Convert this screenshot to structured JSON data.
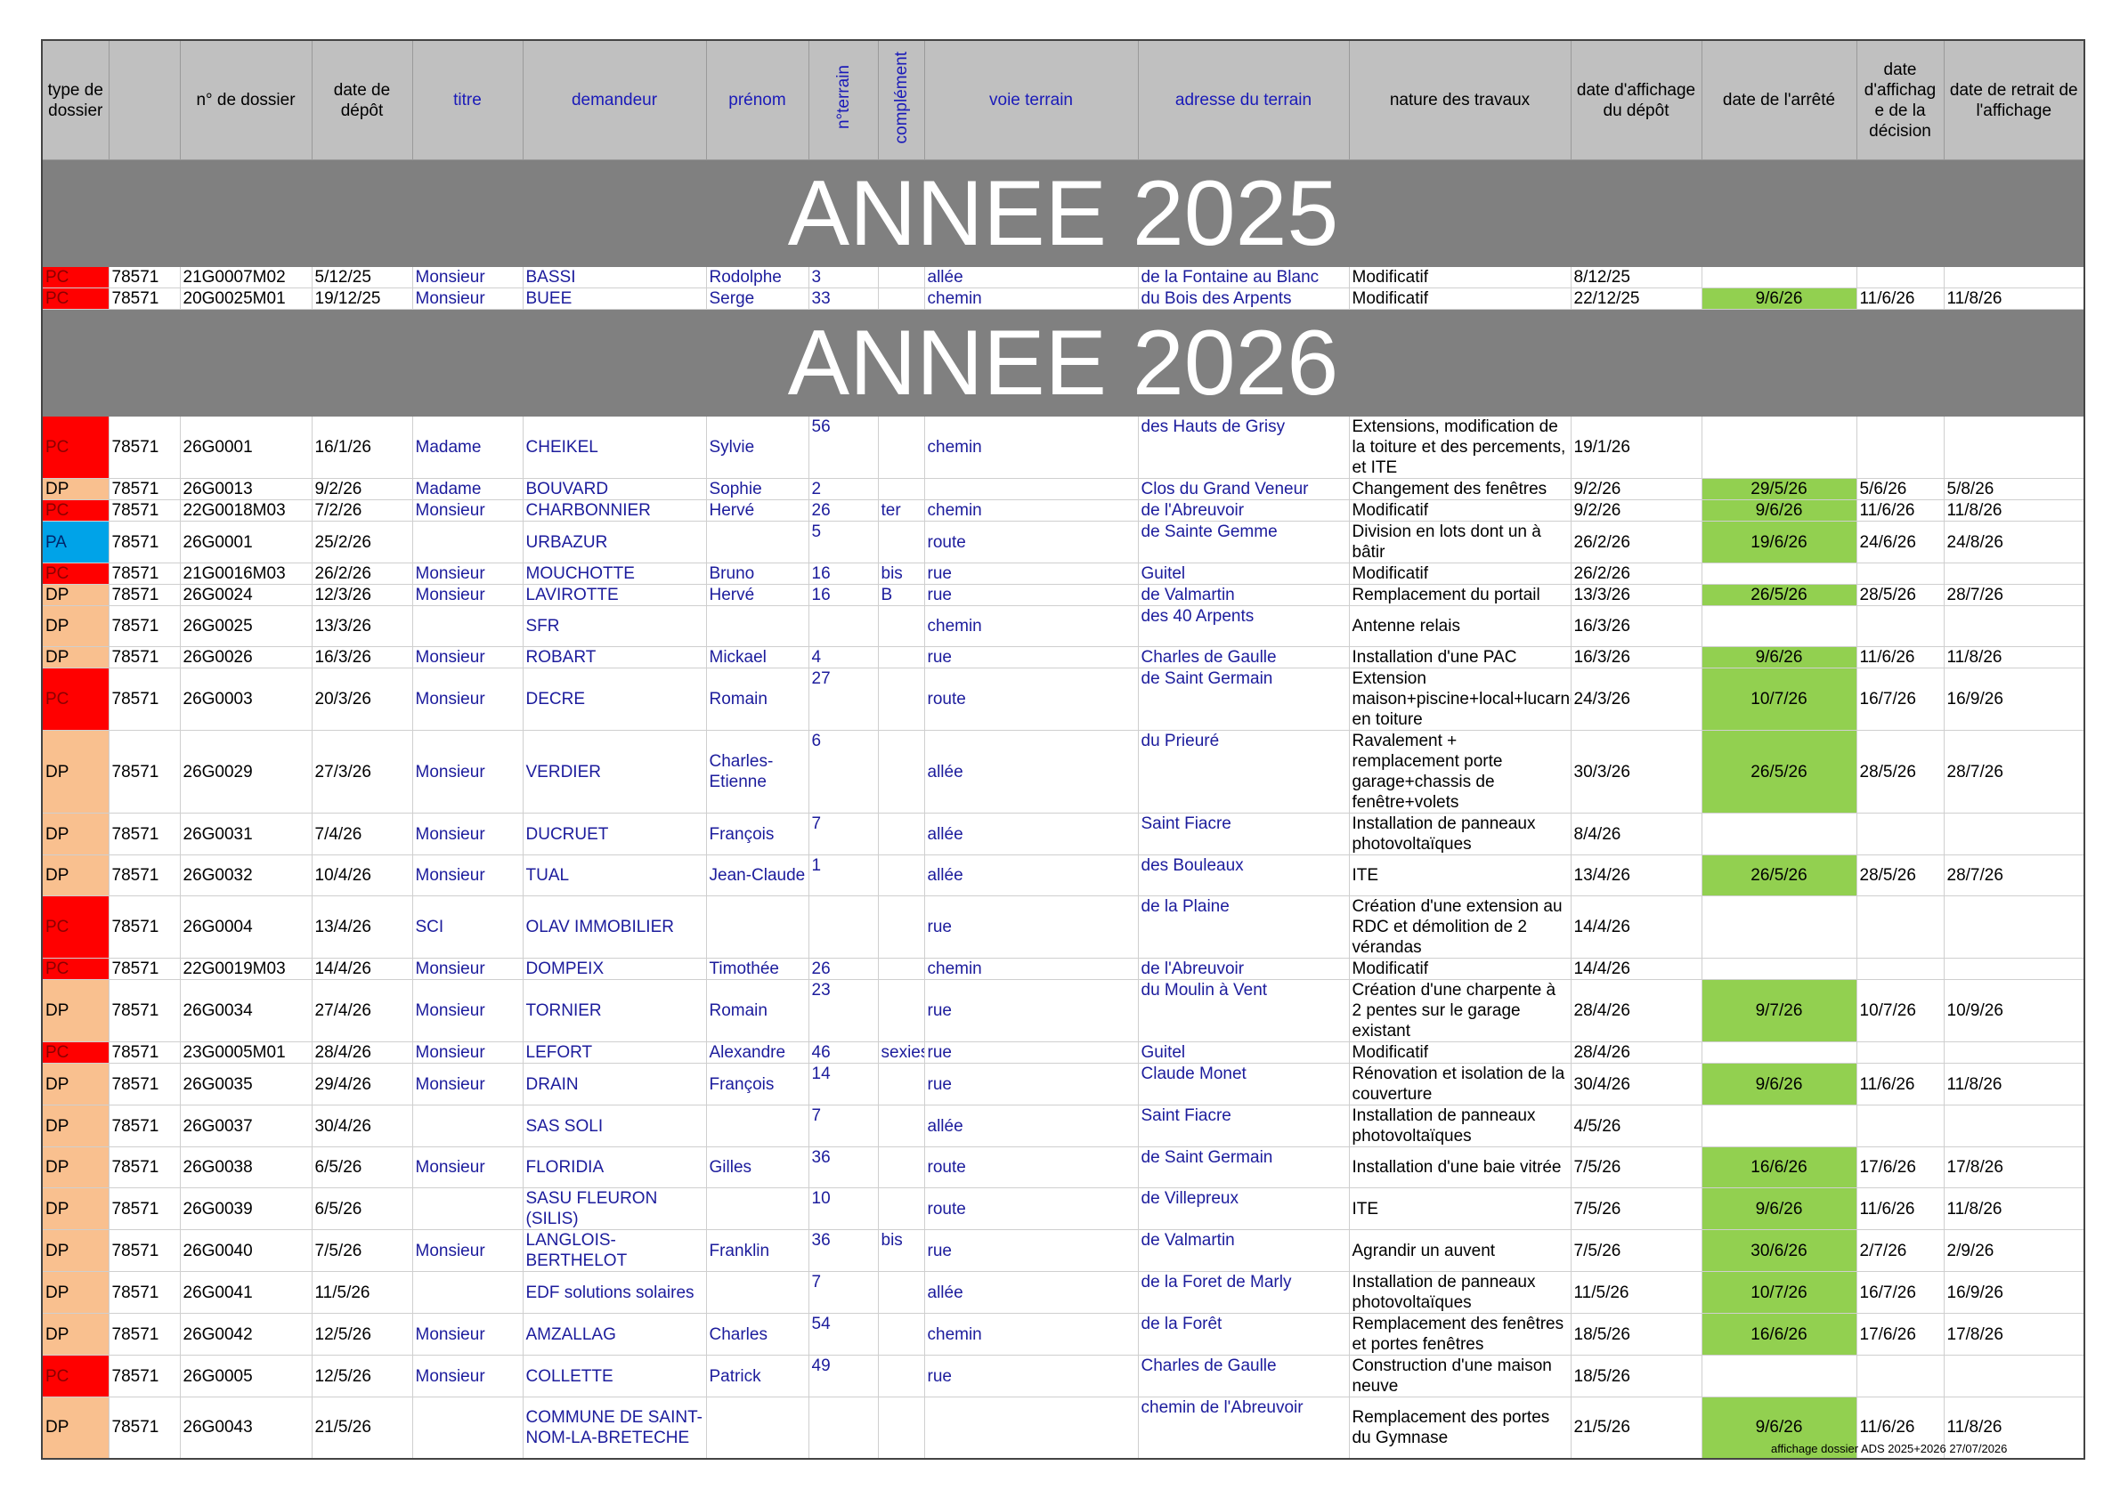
{
  "headers": [
    "type de dossier",
    "",
    "n° de dossier",
    "date de dépôt",
    "titre",
    "demandeur",
    "prénom",
    "n°terrain",
    "complément",
    "voie terrain",
    "adresse du terrain",
    "nature des travaux",
    "date d'affichage du dépôt",
    "date de l'arrêté",
    "date d'affichag e de la décision",
    "date de retrait de l'affichage"
  ],
  "year_2025": "ANNEE 2025",
  "year_2026": "ANNEE 2026",
  "rows_2025": [
    [
      "PC",
      "78571",
      "21G0007M02",
      "5/12/25",
      "Monsieur",
      "BASSI",
      "Rodolphe",
      "3",
      "",
      "allée",
      "de la Fontaine au Blanc",
      "Modificatif",
      "8/12/25",
      "",
      "",
      ""
    ],
    [
      "PC",
      "78571",
      "20G0025M01",
      "19/12/25",
      "Monsieur",
      "BUEE",
      "Serge",
      "33",
      "",
      "chemin",
      "du Bois des Arpents",
      "Modificatif",
      "22/12/25",
      "9/6/26",
      "11/6/26",
      "11/8/26"
    ]
  ],
  "rows_2026": [
    [
      "PC",
      "78571",
      "26G0001",
      "16/1/26",
      "Madame",
      "CHEIKEL",
      "Sylvie",
      "56",
      "",
      "chemin",
      "des Hauts de Grisy",
      "Extensions, modification de la toiture et des percements, et ITE",
      "19/1/26",
      "",
      "",
      ""
    ],
    [
      "DP",
      "78571",
      "26G0013",
      "9/2/26",
      "Madame",
      "BOUVARD",
      "Sophie",
      "2",
      "",
      "",
      "Clos du Grand Veneur",
      "Changement des fenêtres",
      "9/2/26",
      "29/5/26",
      "5/6/26",
      "5/8/26"
    ],
    [
      "PC",
      "78571",
      "22G0018M03",
      "7/2/26",
      "Monsieur",
      "CHARBONNIER",
      "Hervé",
      "26",
      "ter",
      "chemin",
      "de l'Abreuvoir",
      "Modificatif",
      "9/2/26",
      "9/6/26",
      "11/6/26",
      "11/8/26"
    ],
    [
      "PA",
      "78571",
      "26G0001",
      "25/2/26",
      "",
      "URBAZUR",
      "",
      "5",
      "",
      "route",
      "de Sainte Gemme",
      "Division en lots dont un à bâtir",
      "26/2/26",
      "19/6/26",
      "24/6/26",
      "24/8/26"
    ],
    [
      "PC",
      "78571",
      "21G0016M03",
      "26/2/26",
      "Monsieur",
      "MOUCHOTTE",
      "Bruno",
      "16",
      "bis",
      "rue",
      "Guitel",
      "Modificatif",
      "26/2/26",
      "",
      "",
      ""
    ],
    [
      "DP",
      "78571",
      "26G0024",
      "12/3/26",
      "Monsieur",
      "LAVIROTTE",
      "Hervé",
      "16",
      "B",
      "rue",
      "de Valmartin",
      "Remplacement du portail",
      "13/3/26",
      "26/5/26",
      "28/5/26",
      "28/7/26"
    ],
    [
      "DP",
      "78571",
      "26G0025",
      "13/3/26",
      "",
      "SFR",
      "",
      "",
      "",
      "chemin",
      "des 40 Arpents",
      "Antenne relais",
      "16/3/26",
      "",
      "",
      ""
    ],
    [
      "DP",
      "78571",
      "26G0026",
      "16/3/26",
      "Monsieur",
      "ROBART",
      "Mickael",
      "4",
      "",
      "rue",
      "Charles de Gaulle",
      "Installation d'une PAC",
      "16/3/26",
      "9/6/26",
      "11/6/26",
      "11/8/26"
    ],
    [
      "PC",
      "78571",
      "26G0003",
      "20/3/26",
      "Monsieur",
      "DECRE",
      "Romain",
      "27",
      "",
      "route",
      "de Saint Germain",
      "Extension maison+piscine+local+lucarnes en toiture",
      "24/3/26",
      "10/7/26",
      "16/7/26",
      "16/9/26"
    ],
    [
      "DP",
      "78571",
      "26G0029",
      "27/3/26",
      "Monsieur",
      "VERDIER",
      "Charles-Etienne",
      "6",
      "",
      "allée",
      "du Prieuré",
      "Ravalement + remplacement porte garage+chassis de fenêtre+volets",
      "30/3/26",
      "26/5/26",
      "28/5/26",
      "28/7/26"
    ],
    [
      "DP",
      "78571",
      "26G0031",
      "7/4/26",
      "Monsieur",
      "DUCRUET",
      "François",
      "7",
      "",
      "allée",
      "Saint Fiacre",
      "Installation de panneaux photovoltaïques",
      "8/4/26",
      "",
      "",
      ""
    ],
    [
      "DP",
      "78571",
      "26G0032",
      "10/4/26",
      "Monsieur",
      "TUAL",
      "Jean-Claude",
      "1",
      "",
      "allée",
      "des Bouleaux",
      "ITE",
      "13/4/26",
      "26/5/26",
      "28/5/26",
      "28/7/26"
    ],
    [
      "PC",
      "78571",
      "26G0004",
      "13/4/26",
      "SCI",
      "OLAV IMMOBILIER",
      "",
      "",
      "",
      "rue",
      "de la Plaine",
      "Création d'une extension au RDC et démolition de 2 vérandas",
      "14/4/26",
      "",
      "",
      ""
    ],
    [
      "PC",
      "78571",
      "22G0019M03",
      "14/4/26",
      "Monsieur",
      "DOMPEIX",
      "Timothée",
      "26",
      "",
      "chemin",
      "de l'Abreuvoir",
      "Modificatif",
      "14/4/26",
      "",
      "",
      ""
    ],
    [
      "DP",
      "78571",
      "26G0034",
      "27/4/26",
      "Monsieur",
      "TORNIER",
      "Romain",
      "23",
      "",
      "rue",
      "du Moulin à Vent",
      "Création d'une charpente à 2 pentes sur le garage existant",
      "28/4/26",
      "9/7/26",
      "10/7/26",
      "10/9/26"
    ],
    [
      "PC",
      "78571",
      "23G0005M01",
      "28/4/26",
      "Monsieur",
      "LEFORT",
      "Alexandre",
      "46",
      "sexies",
      "rue",
      "Guitel",
      "Modificatif",
      "28/4/26",
      "",
      "",
      ""
    ],
    [
      "DP",
      "78571",
      "26G0035",
      "29/4/26",
      "Monsieur",
      "DRAIN",
      "François",
      "14",
      "",
      "rue",
      "Claude Monet",
      "Rénovation et isolation de la couverture",
      "30/4/26",
      "9/6/26",
      "11/6/26",
      "11/8/26"
    ],
    [
      "DP",
      "78571",
      "26G0037",
      "30/4/26",
      "",
      "SAS SOLI",
      "",
      "7",
      "",
      "allée",
      "Saint Fiacre",
      "Installation de panneaux photovoltaïques",
      "4/5/26",
      "",
      "",
      ""
    ],
    [
      "DP",
      "78571",
      "26G0038",
      "6/5/26",
      "Monsieur",
      "FLORIDIA",
      "Gilles",
      "36",
      "",
      "route",
      "de Saint Germain",
      "Installation d'une baie vitrée",
      "7/5/26",
      "16/6/26",
      "17/6/26",
      "17/8/26"
    ],
    [
      "DP",
      "78571",
      "26G0039",
      "6/5/26",
      "",
      "SASU FLEURON (SILIS)",
      "",
      "10",
      "",
      "route",
      "de Villepreux",
      "ITE",
      "7/5/26",
      "9/6/26",
      "11/6/26",
      "11/8/26"
    ],
    [
      "DP",
      "78571",
      "26G0040",
      "7/5/26",
      "Monsieur",
      "LANGLOIS-BERTHELOT",
      "Franklin",
      "36",
      "bis",
      "rue",
      "de Valmartin",
      "Agrandir un auvent",
      "7/5/26",
      "30/6/26",
      "2/7/26",
      "2/9/26"
    ],
    [
      "DP",
      "78571",
      "26G0041",
      "11/5/26",
      "",
      "EDF solutions solaires",
      "",
      "7",
      "",
      "allée",
      "de la Foret de Marly",
      "Installation de panneaux photovoltaïques",
      "11/5/26",
      "10/7/26",
      "16/7/26",
      "16/9/26"
    ],
    [
      "DP",
      "78571",
      "26G0042",
      "12/5/26",
      "Monsieur",
      "AMZALLAG",
      "Charles",
      "54",
      "",
      "chemin",
      "de la Forêt",
      "Remplacement des fenêtres et portes fenêtres",
      "18/5/26",
      "16/6/26",
      "17/6/26",
      "17/8/26"
    ],
    [
      "PC",
      "78571",
      "26G0005",
      "12/5/26",
      "Monsieur",
      "COLLETTE",
      "Patrick",
      "49",
      "",
      "rue",
      "Charles de Gaulle",
      "Construction d'une maison neuve",
      "18/5/26",
      "",
      "",
      ""
    ],
    [
      "DP",
      "78571",
      "26G0043",
      "21/5/26",
      "",
      "COMMUNE DE SAINT-NOM-LA-BRETECHE",
      "",
      "",
      "",
      "",
      "chemin de l'Abreuvoir",
      "Remplacement des portes du Gymnase",
      "21/5/26",
      "9/6/26",
      "11/6/26",
      "11/8/26"
    ]
  ],
  "footer": "affichage dossier ADS 2025+2026 27/07/2026",
  "colors": {
    "PC": "#ff0000",
    "DP": "#f9c08f",
    "PA": "#00a3e8",
    "green": "#92d050",
    "header": "#c0c0c0",
    "year_band": "#808080"
  }
}
